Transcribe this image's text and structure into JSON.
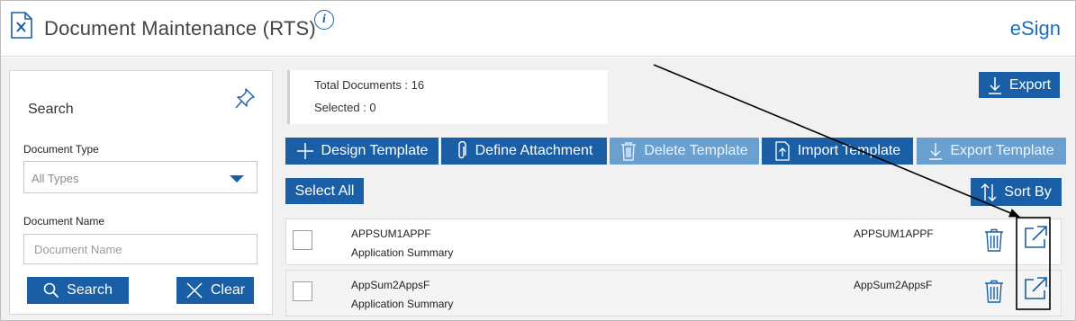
{
  "header": {
    "title": "Document Maintenance (RTS)",
    "info_glyph": "i",
    "brand": "eSign",
    "icons": [
      "document-tools-icon",
      "info-icon"
    ]
  },
  "search": {
    "title": "Search",
    "document_type_label": "Document Type",
    "document_type_value": "All Types",
    "document_name_label": "Document Name",
    "document_name_placeholder": "Document Name",
    "search_button": "Search",
    "clear_button": "Clear",
    "icons": [
      "pin-icon",
      "chevron-down-icon",
      "search-icon",
      "close-icon"
    ]
  },
  "summary": {
    "total_documents": "Total Documents : 16",
    "selected": "Selected : 0"
  },
  "toolbar": {
    "export": "Export",
    "design_template": "Design Template",
    "define_attachment": "Define Attachment",
    "delete_template": "Delete Template",
    "import_template": "Import Template",
    "export_template": "Export Template",
    "select_all": "Select All",
    "sort_by": "Sort By"
  },
  "rows": [
    {
      "code": "APPSUM1APPF",
      "description": "Application Summary",
      "code_right": "APPSUM1APPF"
    },
    {
      "code": "AppSum2AppsF",
      "description": "Application Summary",
      "code_right": "AppSum2AppsF"
    }
  ],
  "colors": {
    "primary": "#1a5fa5",
    "primary_disabled": "#6aa0d0",
    "brand": "#1f6fc0",
    "background": "#f1f1f1"
  }
}
